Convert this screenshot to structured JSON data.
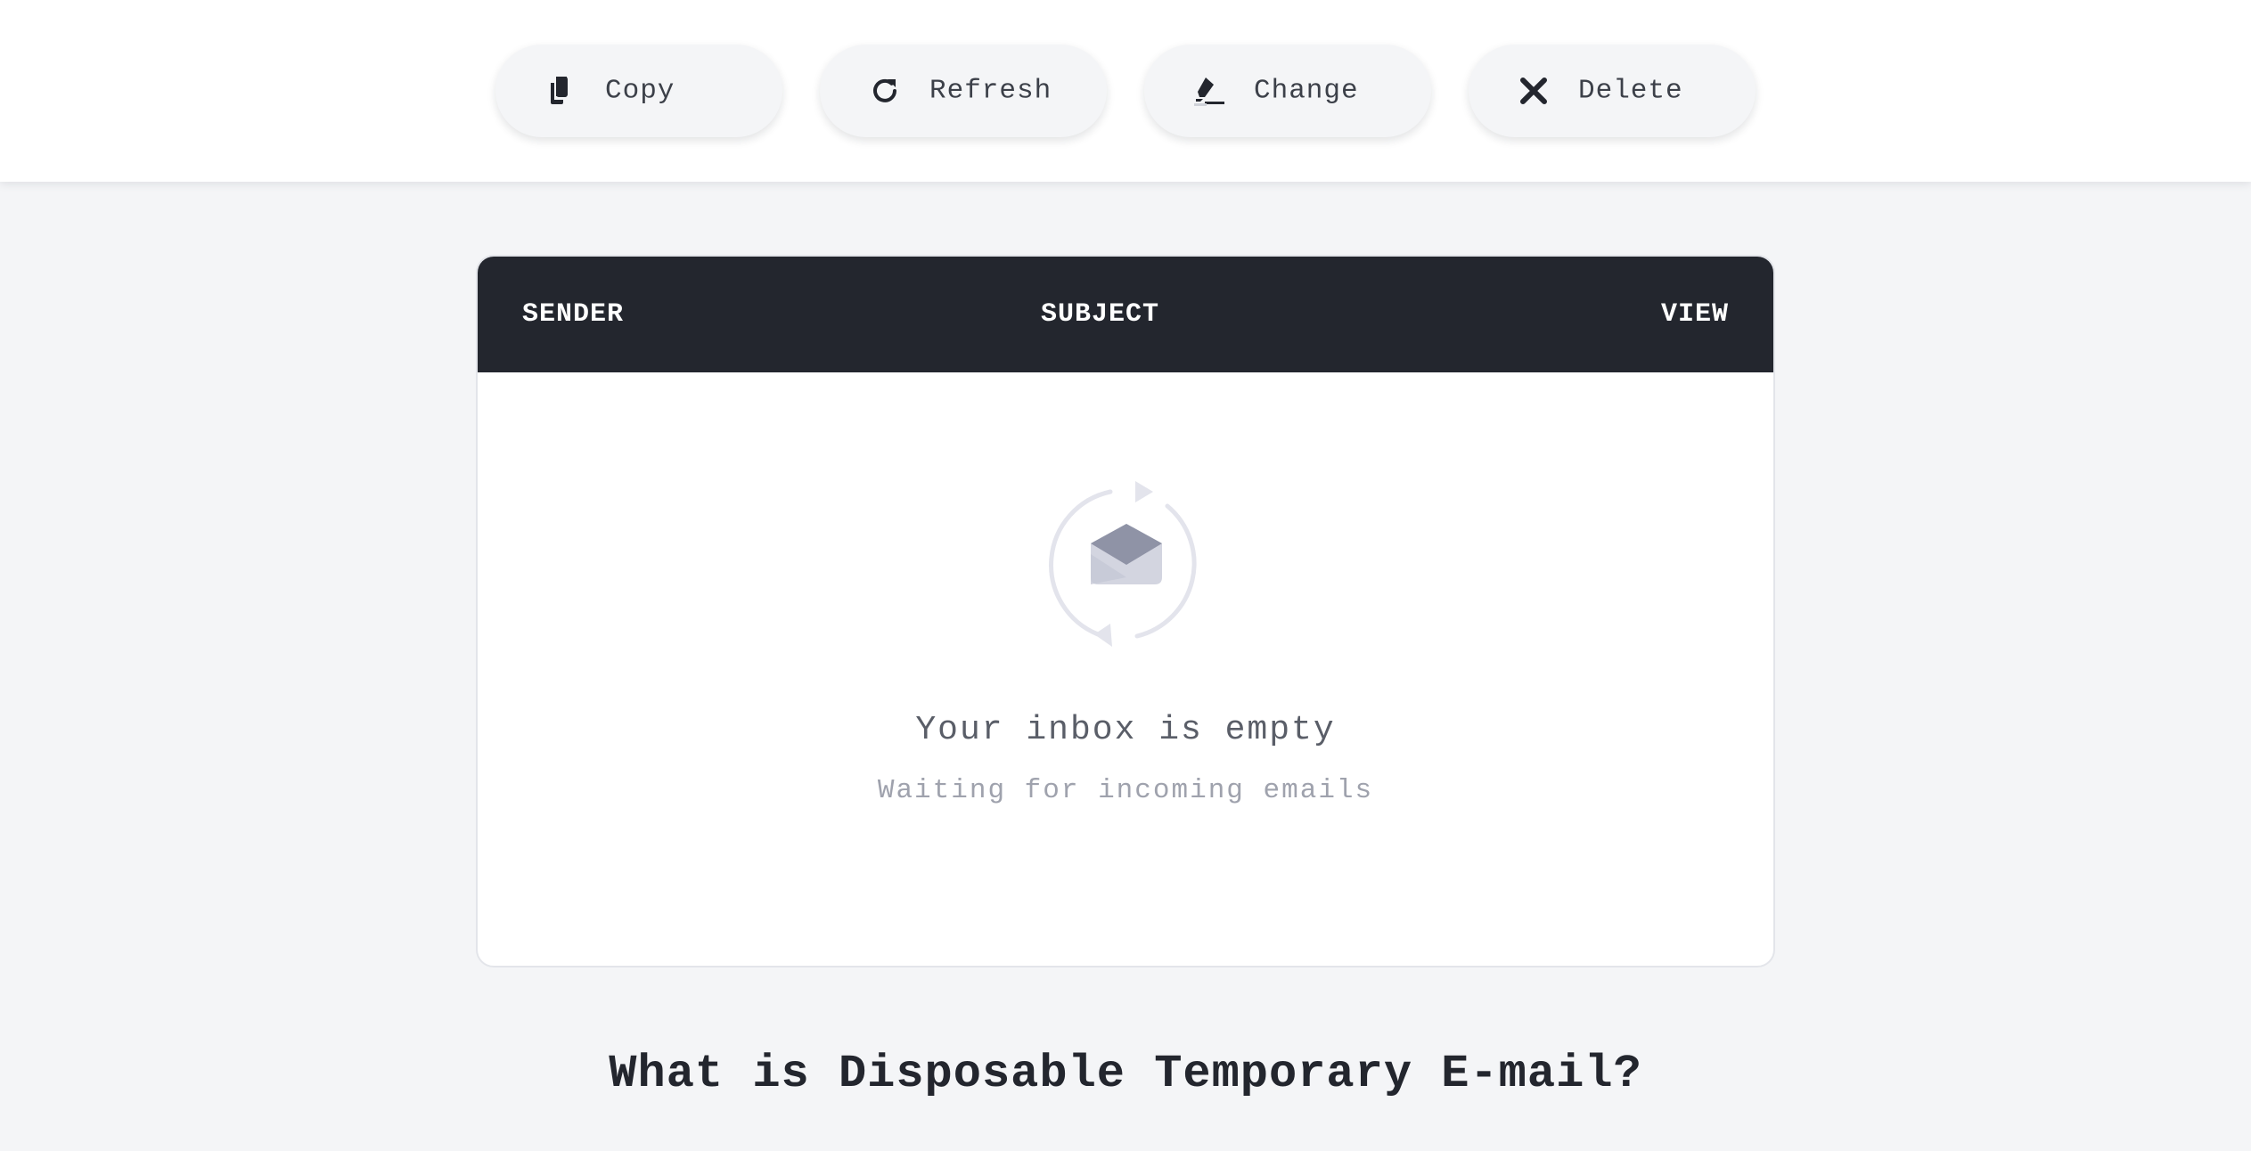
{
  "toolbar": {
    "buttons": [
      {
        "id": "copy",
        "label": "Copy",
        "icon": "copy-icon"
      },
      {
        "id": "refresh",
        "label": "Refresh",
        "icon": "refresh-icon"
      },
      {
        "id": "change",
        "label": "Change",
        "icon": "pen-icon"
      },
      {
        "id": "delete",
        "label": "Delete",
        "icon": "close-icon"
      }
    ]
  },
  "inbox": {
    "columns": {
      "sender": "SENDER",
      "subject": "SUBJECT",
      "view": "VIEW"
    },
    "empty": {
      "title": "Your inbox is empty",
      "subtitle": "Waiting for incoming emails",
      "icon": "empty-inbox-icon"
    }
  },
  "section": {
    "heading": "What is Disposable Temporary E-mail?"
  },
  "colors": {
    "header_bg": "#23262e",
    "page_bg": "#f4f5f7",
    "button_bg": "#f4f5f7",
    "muted_text": "#9fa2ad"
  }
}
